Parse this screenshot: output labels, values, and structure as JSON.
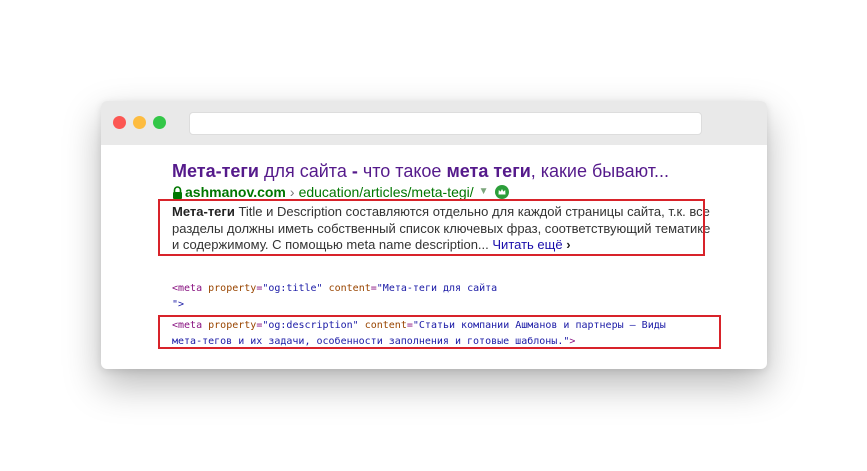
{
  "browser": {
    "traffic_lights": [
      "close",
      "minimize",
      "maximize"
    ],
    "colors": {
      "close": "#fc5753",
      "minimize": "#fdbc40",
      "maximize": "#33c748"
    }
  },
  "result": {
    "title_parts": [
      {
        "text": "Мета-теги",
        "bold": true
      },
      {
        "text": " для сайта ",
        "bold": false
      },
      {
        "text": "-",
        "bold": true
      },
      {
        "text": " что такое ",
        "bold": false
      },
      {
        "text": "мета теги",
        "bold": true
      },
      {
        "text": ", какие бывают...",
        "bold": false
      }
    ],
    "domain": "ashmanov.com",
    "separator": "›",
    "path": "education/articles/meta-tegi/",
    "snippet_bold": "Мета-теги",
    "snippet_text": " Title и Description составляются отдельно для каждой страницы сайта, т.к. все разделы должны иметь собственный список ключевых фраз, соответствующий тематике и содержимому. С помощью meta name description...",
    "read_more": "Читать ещё",
    "read_more_arrow": "›"
  },
  "code": {
    "og_title": {
      "tag": "<meta",
      "attr1": "property",
      "val1": "\"og:title\"",
      "attr2": "content",
      "val2": "\"Мета-теги для сайта",
      "closing": "\">"
    },
    "og_description": {
      "tag": "<meta",
      "attr1": "property",
      "val1": "\"og:description\"",
      "attr2": "content",
      "val2_line1": "\"Статьи компании Ашманов и партнеры – Виды",
      "val2_line2": "мета-тегов и их задачи, особенности заполнения и готовые шаблоны.\"",
      "closing": ">"
    }
  },
  "colors": {
    "highlight_box": "#d8232a",
    "title_link": "#551a8b",
    "url_green": "#007700",
    "read_more": "#1a0dab"
  }
}
